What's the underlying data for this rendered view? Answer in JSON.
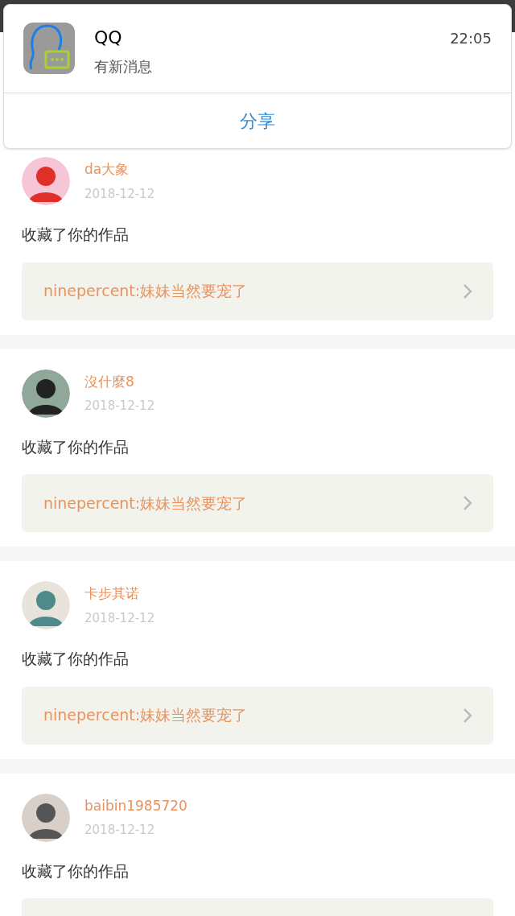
{
  "notification": {
    "app_name": "QQ",
    "message": "有新消息",
    "time": "22:05",
    "action": "分享"
  },
  "feed": [
    {
      "user": "da大象",
      "date": "2018-12-12",
      "action": "收藏了你的作品",
      "quote": "ninepercent:妹妹当然要宠了"
    },
    {
      "user": "沒什麼8",
      "date": "2018-12-12",
      "action": "收藏了你的作品",
      "quote": "ninepercent:妹妹当然要宠了"
    },
    {
      "user": "卡步其诺",
      "date": "2018-12-12",
      "action": "收藏了你的作品",
      "quote": "ninepercent:妹妹当然要宠了"
    },
    {
      "user": "baibin1985720",
      "date": "2018-12-12",
      "action": "收藏了你的作品"
    }
  ]
}
